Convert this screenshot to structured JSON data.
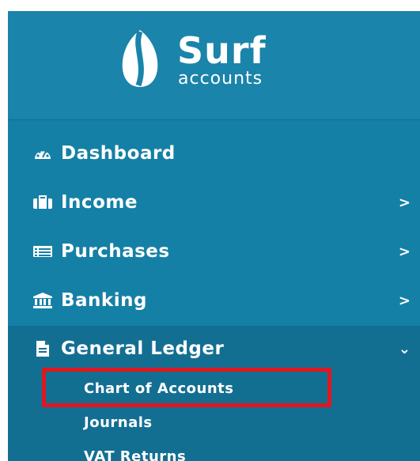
{
  "brand": {
    "name": "Surf",
    "sub": "accounts"
  },
  "colors": {
    "sidebar": "#1580a6",
    "active_section": "#136f92",
    "highlight": "#e0171f",
    "text": "#ffffff"
  },
  "nav": [
    {
      "label": "Dashboard",
      "icon": "dashboard-icon",
      "chevron": ""
    },
    {
      "label": "Income",
      "icon": "briefcase-icon",
      "chevron": ">"
    },
    {
      "label": "Purchases",
      "icon": "list-icon",
      "chevron": ">"
    },
    {
      "label": "Banking",
      "icon": "bank-icon",
      "chevron": ">"
    },
    {
      "label": "General Ledger",
      "icon": "document-icon",
      "chevron": "⌄"
    }
  ],
  "general_ledger_items": [
    {
      "label": "Chart of Accounts"
    },
    {
      "label": "Journals"
    },
    {
      "label": "VAT Returns"
    }
  ]
}
